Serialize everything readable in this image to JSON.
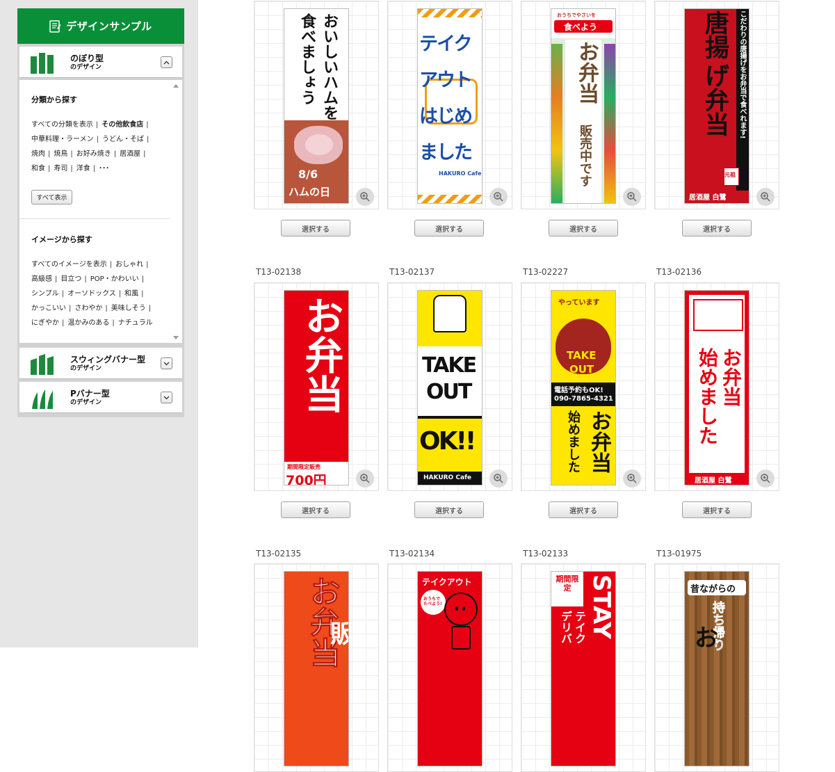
{
  "sidebar": {
    "header_title": "デザインサンプル",
    "types": [
      {
        "title": "のぼり型",
        "subtitle": "のデザイン",
        "expanded": true
      },
      {
        "title": "スウィングバナー型",
        "subtitle": "のデザイン",
        "expanded": false
      },
      {
        "title": "Pバナー型",
        "subtitle": "のデザイン",
        "expanded": false
      }
    ],
    "category_section": {
      "title": "分類から探す",
      "lines": [
        [
          "すべての分類を表示",
          "その他飲食店"
        ],
        [
          "中華料理・ラーメン",
          "うどん・そば"
        ],
        [
          "焼肉",
          "焼鳥",
          "お好み焼き",
          "居酒屋"
        ],
        [
          "和食",
          "寿司",
          "洋食",
          "･･･"
        ]
      ],
      "show_all_label": "すべて表示"
    },
    "image_section": {
      "title": "イメージから探す",
      "lines": [
        [
          "すべてのイメージを表示",
          "おしゃれ"
        ],
        [
          "高級感",
          "目立つ",
          "POP・かわいい"
        ],
        [
          "シンプル",
          "オーソドックス",
          "和風"
        ],
        [
          "かっこいい",
          "さわやか",
          "美味しそう"
        ],
        [
          "にぎやか",
          "温かみのある",
          "ナチュラル"
        ]
      ]
    }
  },
  "grid": {
    "select_label": "選択する",
    "rows": [
      {
        "codes": [
          "",
          "",
          "",
          ""
        ]
      },
      {
        "codes": [
          "T13-02138",
          "T13-02137",
          "T13-02227",
          "T13-02136"
        ]
      },
      {
        "codes": [
          "T13-02135",
          "T13-02134",
          "T13-02133",
          "T13-01975"
        ]
      }
    ]
  },
  "banners": {
    "b1": {
      "main1": "おいしいハムを",
      "main2": "食べましょう",
      "date": "8/6",
      "day": "ハムの日"
    },
    "b2": {
      "line1": "テイク",
      "line2": "アウト",
      "line3": "はじめ",
      "line4": "ました",
      "brand": "HAKURO Cafe"
    },
    "b3": {
      "top_small": "おうちでやさいを",
      "top": "食べよう",
      "main": "お弁当",
      "sub": "販売中です"
    },
    "b4": {
      "side": "こだわりの唐揚げをお弁当で食べれます!",
      "main1": "唐揚",
      "main2": "げ弁当",
      "seal": "元祖",
      "shop": "居酒屋 白鷺"
    },
    "b5": {
      "main": "お弁当",
      "sale": "期間限定販売",
      "price": "700円"
    },
    "b6": {
      "take": "TAKE",
      "out": "OUT",
      "ok": "OK!!",
      "brand": "HAKURO Cafe"
    },
    "b7": {
      "top": "やっています",
      "take": "TAKE",
      "out": "OUT",
      "tel_label": "電話予約もOK!",
      "tel": "090-7865-4321",
      "main": "お弁当",
      "sub": "始めました"
    },
    "b8": {
      "main1": "お弁当",
      "main2": "始めました",
      "shop": "居酒屋 白鷺"
    },
    "b9": {
      "main": "お弁当",
      "sub": "販"
    },
    "b10": {
      "top": "テイクアウト",
      "bubble": "おうちで たべよう!"
    },
    "b11": {
      "limited": "期間限定",
      "stay": "STAY",
      "sub1": "テイク",
      "sub2": "デリバ"
    },
    "b12": {
      "top": "昔ながらの",
      "main": "持ち帰り",
      "big": "お"
    }
  },
  "colors": {
    "brand_green": "#0a8f39",
    "banner_red": "#e50012",
    "banner_yellow": "#ffe600",
    "banner_blue": "#1c4fa6"
  }
}
